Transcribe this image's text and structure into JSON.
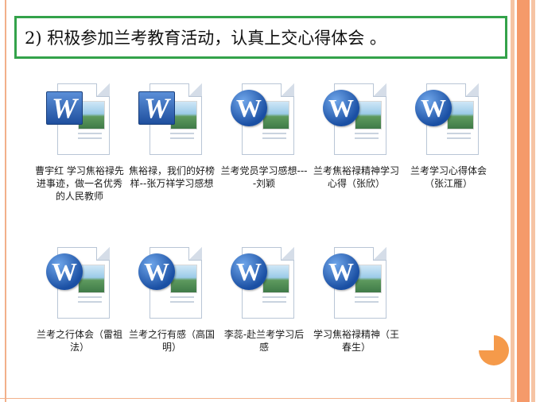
{
  "heading": "2) 积极参加兰考教育活动，认真上交心得体会 。",
  "colors": {
    "heading_border": "#33a24a",
    "accent_orange": "#f59a6a",
    "word_blue": "#1f4f9e"
  },
  "files": [
    {
      "label": "曹宇红 学习焦裕禄先进事迹，做一名优秀的人民教师",
      "icon": "word-document-icon"
    },
    {
      "label": "焦裕禄，我们的好榜样--张万祥学习感想",
      "icon": "word-document-icon"
    },
    {
      "label": "兰考党员学习感想----刘颖",
      "icon": "word-document-icon"
    },
    {
      "label": "兰考焦裕禄精神学习心得（张欣）",
      "icon": "word-document-icon"
    },
    {
      "label": "兰考学习心得体会（张江雁）",
      "icon": "word-document-icon"
    },
    {
      "label": "兰考之行体会（雷祖法）",
      "icon": "word-document-icon"
    },
    {
      "label": "兰考之行有感（高国明）",
      "icon": "word-document-icon"
    },
    {
      "label": "李蕊-赴兰考学习后感",
      "icon": "word-document-icon"
    },
    {
      "label": "学习焦裕禄精神（王春生）",
      "icon": "word-document-icon"
    }
  ]
}
